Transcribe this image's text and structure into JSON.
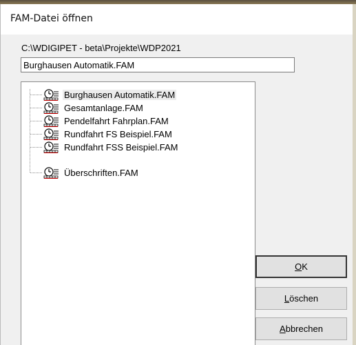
{
  "dialog": {
    "title": "FAM-Datei öffnen",
    "path": "C:\\WDIGIPET - beta\\Projekte\\WDP2021",
    "filename_value": "Burghausen Automatik.FAM"
  },
  "tree": {
    "items": [
      {
        "label": "Burghausen Automatik.FAM",
        "selected": true
      },
      {
        "label": "Gesamtanlage.FAM",
        "selected": false
      },
      {
        "label": "Pendelfahrt Fahrplan.FAM",
        "selected": false
      },
      {
        "label": "Rundfahrt FS Beispiel.FAM",
        "selected": false
      },
      {
        "label": "Rundfahrt FSS Beispiel.FAM",
        "selected": false
      },
      {
        "label": "Überschriften.FAM",
        "selected": false
      }
    ]
  },
  "buttons": {
    "ok": {
      "accel": "O",
      "rest": "K"
    },
    "delete": {
      "accel": "L",
      "rest": "öschen"
    },
    "cancel": {
      "accel": "A",
      "rest": "bbrechen"
    }
  },
  "icons": {
    "file_item": "clock-timetable-icon"
  }
}
